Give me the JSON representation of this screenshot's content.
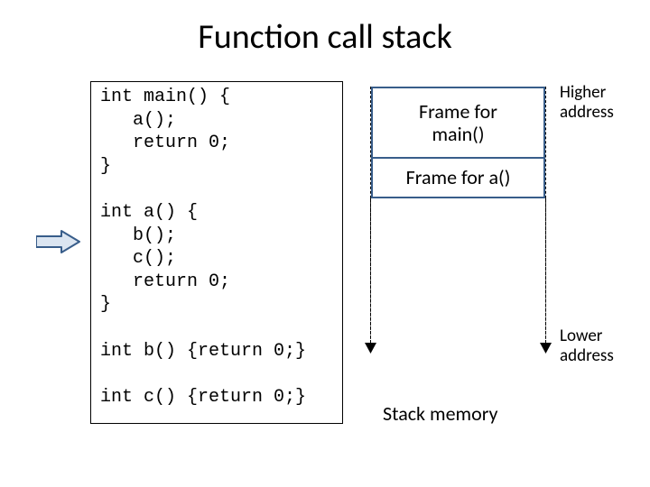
{
  "title": "Function call stack",
  "code": "int main() {\n   a();\n   return 0;\n}\n\nint a() {\n   b();\n   c();\n   return 0;\n}\n\nint b() {return 0;}\n\nint c() {return 0;}",
  "stack": {
    "frames": [
      {
        "label": "Frame for\nmain()"
      },
      {
        "label": "Frame for a()"
      }
    ],
    "caption": "Stack memory",
    "higher": "Higher\naddress",
    "lower": "Lower\naddress"
  },
  "pointer": {
    "points_at": "int a() {"
  }
}
